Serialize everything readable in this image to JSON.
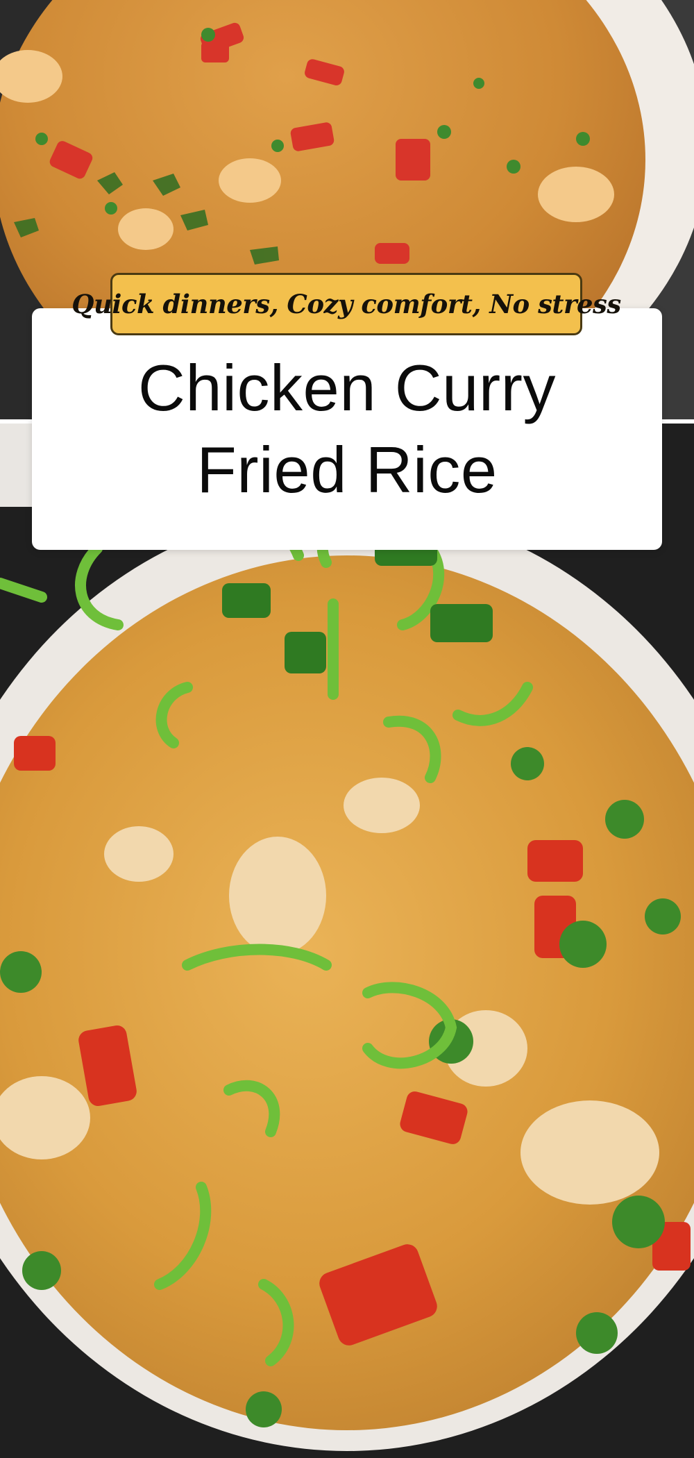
{
  "tagline": "Quick dinners, Cozy comfort, No stress",
  "title": {
    "line1": "Chicken Curry",
    "line2": "Fried Rice"
  },
  "photos": {
    "top": "fried-rice-bowl-photo",
    "bottom": "fried-rice-bowl-closeup-photo"
  },
  "colors": {
    "rice": "#d99a3c",
    "tagline_bg": "#f3c04d",
    "card_bg": "#ffffff",
    "title_text": "#0b0b0b"
  }
}
